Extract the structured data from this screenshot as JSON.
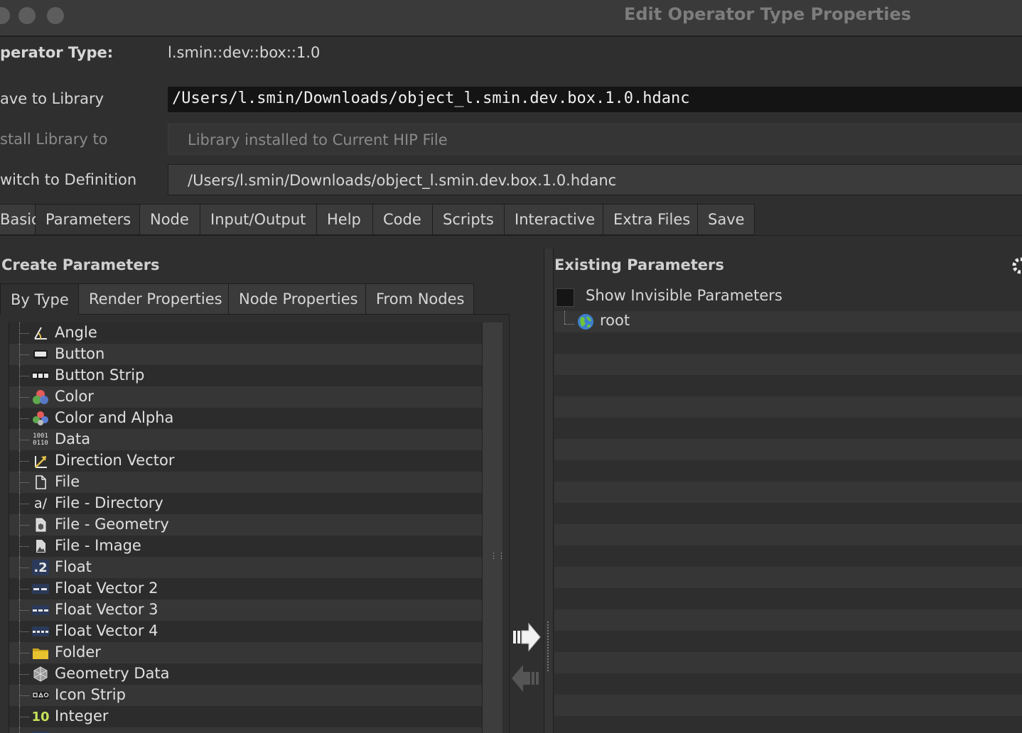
{
  "window": {
    "title": "Edit Operator Type Properties"
  },
  "header": {
    "operator_type_label": "perator Type:",
    "operator_type_value": "l.smin::dev::box::1.0",
    "save_library_label": "ave to Library",
    "save_library_value": "/Users/l.smin/Downloads/object_l.smin.dev.box.1.0.hdanc",
    "install_label": "stall Library to",
    "install_value": "Library installed to Current HIP File",
    "switch_label": "witch to Definition",
    "switch_value": "/Users/l.smin/Downloads/object_l.smin.dev.box.1.0.hdanc"
  },
  "tabs": [
    "Basic",
    "Parameters",
    "Node",
    "Input/Output",
    "Help",
    "Code",
    "Scripts",
    "Interactive",
    "Extra Files",
    "Save"
  ],
  "active_tab": "Parameters",
  "create_params": {
    "title": "Create Parameters",
    "subtabs": [
      "By Type",
      "Render Properties",
      "Node Properties",
      "From Nodes"
    ],
    "items": [
      {
        "label": "Angle",
        "icon": "angle-icon"
      },
      {
        "label": "Button",
        "icon": "button-icon"
      },
      {
        "label": "Button Strip",
        "icon": "button-strip-icon"
      },
      {
        "label": "Color",
        "icon": "color-icon"
      },
      {
        "label": "Color and Alpha",
        "icon": "color-alpha-icon"
      },
      {
        "label": "Data",
        "icon": "data-icon"
      },
      {
        "label": "Direction Vector",
        "icon": "direction-vector-icon"
      },
      {
        "label": "File",
        "icon": "file-icon"
      },
      {
        "label": "File - Directory",
        "icon": "file-directory-icon"
      },
      {
        "label": "File - Geometry",
        "icon": "file-geometry-icon"
      },
      {
        "label": "File - Image",
        "icon": "file-image-icon"
      },
      {
        "label": "Float",
        "icon": "float-icon"
      },
      {
        "label": "Float Vector 2",
        "icon": "float-vector2-icon"
      },
      {
        "label": "Float Vector 3",
        "icon": "float-vector3-icon"
      },
      {
        "label": "Float Vector 4",
        "icon": "float-vector4-icon"
      },
      {
        "label": "Folder",
        "icon": "folder-icon"
      },
      {
        "label": "Geometry Data",
        "icon": "geometry-data-icon"
      },
      {
        "label": "Icon Strip",
        "icon": "icon-strip-icon"
      },
      {
        "label": "Integer",
        "icon": "integer-icon"
      },
      {
        "label": "",
        "icon": "integer-vector-icon"
      }
    ],
    "icon_text": {
      "data_top": "1001",
      "data_bottom": "0110",
      "float": ".2",
      "integer": "10",
      "file_dir": "a/"
    }
  },
  "existing_params": {
    "title": "Existing Parameters",
    "show_invisible_label": "Show Invisible Parameters",
    "root_label": "root"
  }
}
